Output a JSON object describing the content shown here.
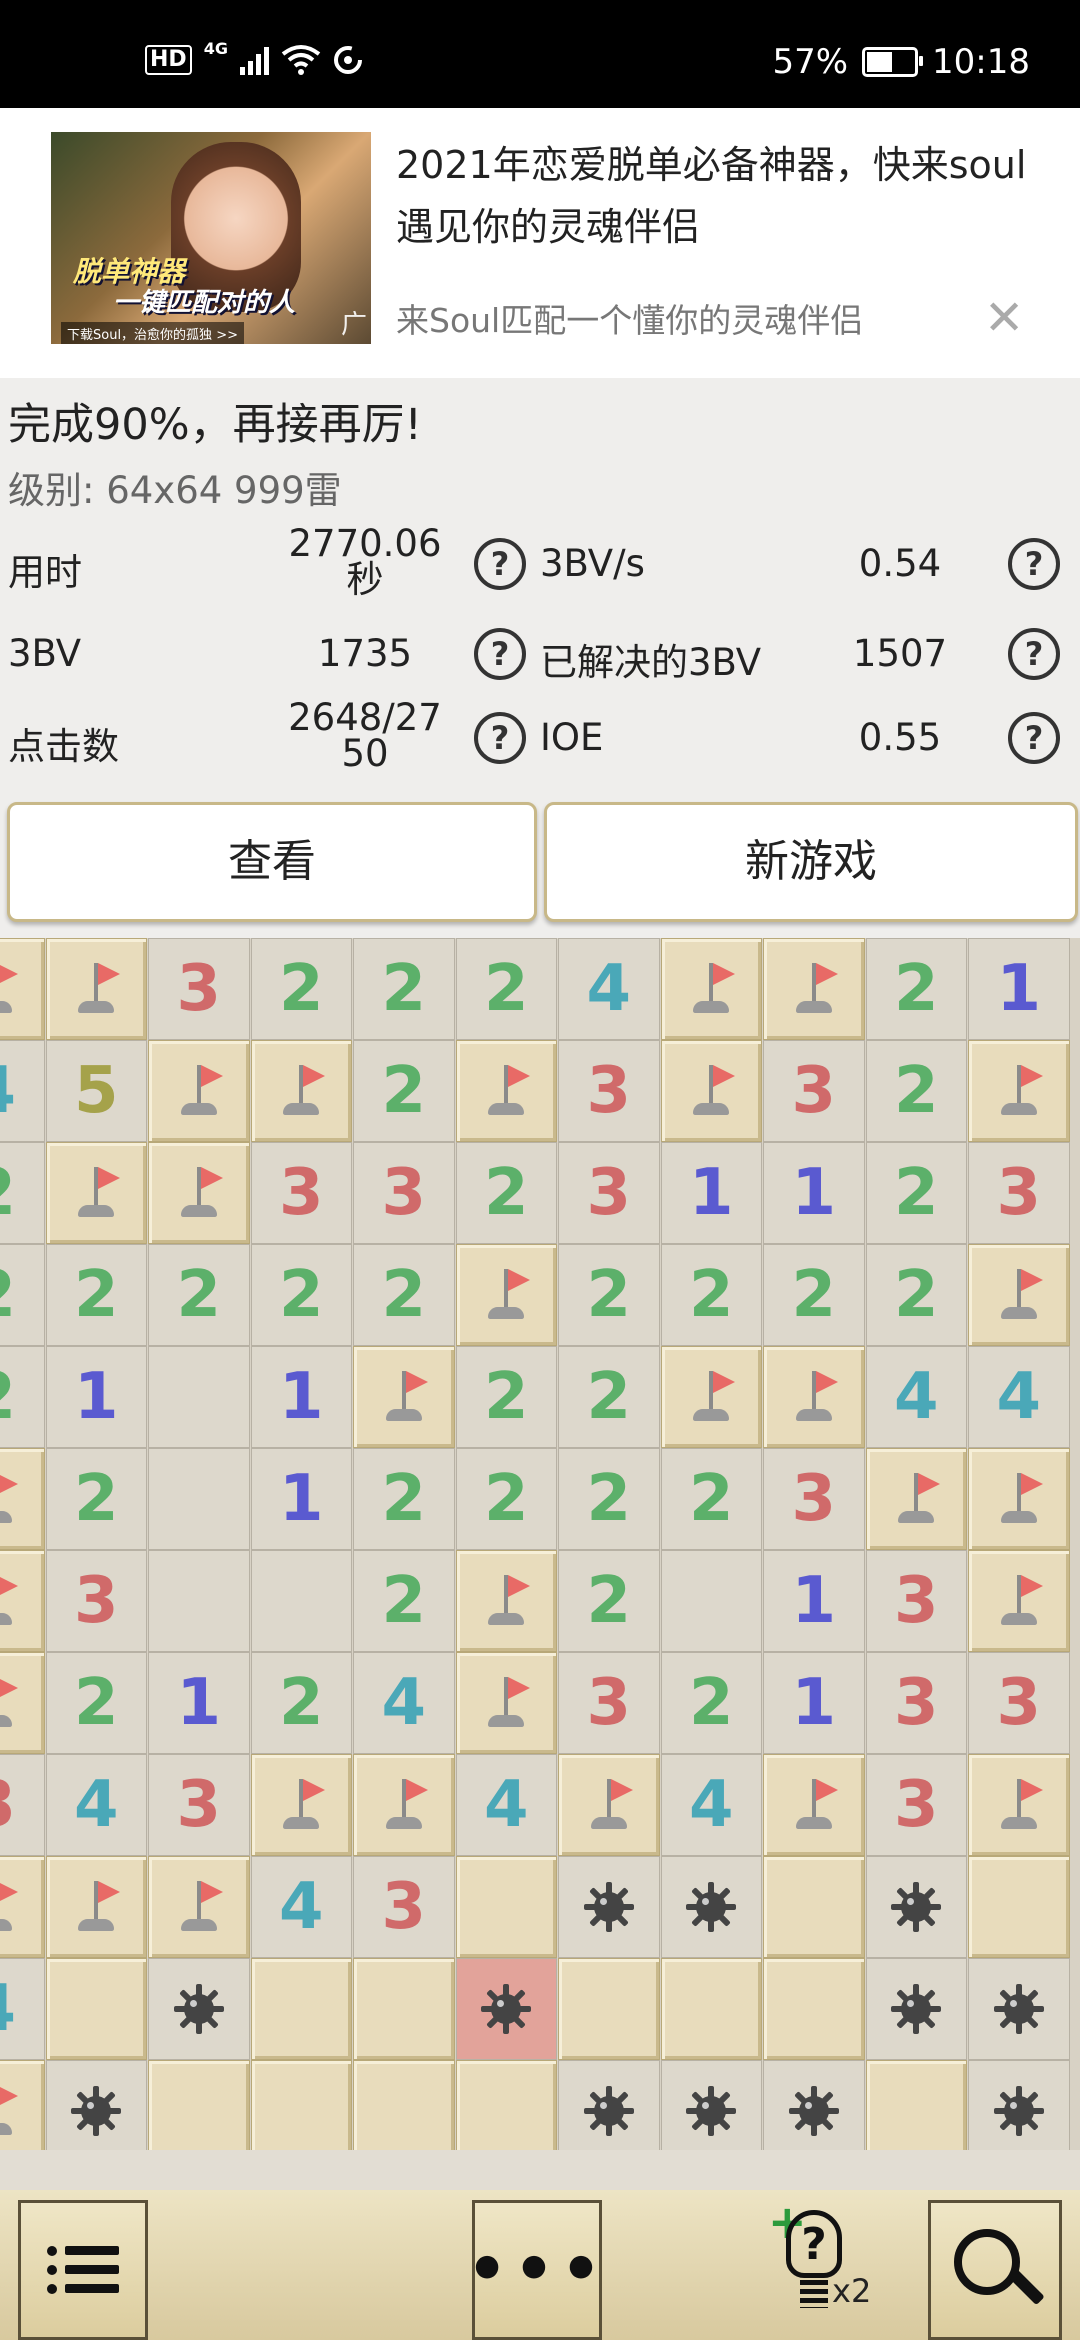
{
  "status_bar": {
    "hd": "HD",
    "network": "4G",
    "battery_pct": "57%",
    "battery_level": 0.57,
    "time": "10:18"
  },
  "ad": {
    "image_overlay_1": "脱单神器",
    "image_overlay_2": "一键匹配对的人",
    "image_caption": "下载Soul，治愈你的孤独 >>",
    "label": "广告",
    "title": "2021年恋爱脱单必备神器，快来soul遇见你的灵魂伴侣",
    "description": "来Soul匹配一个懂你的灵魂伴侣",
    "close_icon": "close-icon"
  },
  "stats": {
    "message": "完成90%，再接再厉!",
    "level": "级别: 64x64  999雷",
    "rows": [
      {
        "left_label": "用时",
        "left_value_line1": "2770.06",
        "left_value_line2": "秒",
        "right_label": "3BV/s",
        "right_value": "0.54"
      },
      {
        "left_label": "3BV",
        "left_value_line1": "1735",
        "left_value_line2": "",
        "right_label": "已解决的3BV",
        "right_value": "1507"
      },
      {
        "left_label": "点击数",
        "left_value_line1": "2648/27",
        "left_value_line2": "50",
        "right_label": "IOE",
        "right_value": "0.55"
      }
    ],
    "help_glyph": "?"
  },
  "actions": {
    "view_label": "查看",
    "new_game_label": "新游戏"
  },
  "board": {
    "legend": "Cells: F=flag, M=mine, X=exploded mine, C=covered, 0=revealed blank, 1-5=numbers",
    "rows": [
      [
        "F",
        "F",
        "3",
        "2",
        "2",
        "2",
        "4",
        "F",
        "F",
        "2",
        "1"
      ],
      [
        "4",
        "5",
        "F",
        "F",
        "2",
        "F",
        "3",
        "F",
        "3",
        "2",
        "F"
      ],
      [
        "2",
        "F",
        "F",
        "3",
        "3",
        "2",
        "3",
        "1",
        "1",
        "2",
        "3"
      ],
      [
        "2",
        "2",
        "2",
        "2",
        "2",
        "F",
        "2",
        "2",
        "2",
        "2",
        "F"
      ],
      [
        "2",
        "1",
        "0",
        "1",
        "F",
        "2",
        "2",
        "F",
        "F",
        "4",
        "4"
      ],
      [
        "F",
        "2",
        "0",
        "1",
        "2",
        "2",
        "2",
        "2",
        "3",
        "F",
        "F"
      ],
      [
        "F",
        "3",
        "0",
        "0",
        "2",
        "F",
        "2",
        "0",
        "1",
        "3",
        "F"
      ],
      [
        "F",
        "2",
        "1",
        "2",
        "4",
        "F",
        "3",
        "2",
        "1",
        "3",
        "3"
      ],
      [
        "3",
        "4",
        "3",
        "F",
        "F",
        "4",
        "F",
        "4",
        "F",
        "3",
        "F"
      ],
      [
        "F",
        "F",
        "F",
        "4",
        "3",
        "C",
        "M",
        "M",
        "C",
        "M",
        "C"
      ],
      [
        "4",
        "C",
        "M",
        "C",
        "C",
        "X",
        "C",
        "C",
        "C",
        "M",
        "M"
      ],
      [
        "F",
        "M",
        "C",
        "C",
        "C",
        "C",
        "M",
        "M",
        "M",
        "C",
        "M"
      ]
    ]
  },
  "bottom_bar": {
    "menu_icon": "list-menu-icon",
    "more_glyph": "•••",
    "hint_plus": "+",
    "hint_glyph": "?",
    "hint_count": "x2",
    "search_icon": "magnifier-icon"
  },
  "colors": {
    "number_1": "#5a5ad0",
    "number_2": "#5cb06a",
    "number_3": "#d06a6a",
    "number_4": "#4aa8b8",
    "number_5": "#a5a24a",
    "flag": "#e86a66",
    "exploded_cell": "#e2a39a",
    "button_border": "#c8b888"
  }
}
